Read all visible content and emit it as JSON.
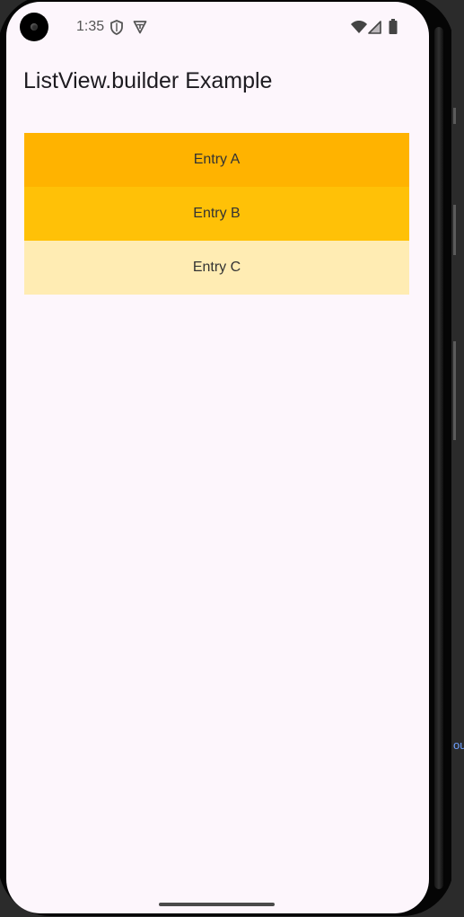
{
  "status_bar": {
    "time": "1:35",
    "icons": [
      "shield-icon",
      "vpn-key-icon",
      "wifi-icon",
      "signal-icon",
      "battery-icon"
    ]
  },
  "app": {
    "title": "ListView.builder Example"
  },
  "list": {
    "items": [
      {
        "label": "Entry A",
        "color": "#ffb300"
      },
      {
        "label": "Entry B",
        "color": "#ffc107"
      },
      {
        "label": "Entry C",
        "color": "#ffecb3"
      }
    ]
  },
  "theme": {
    "background": "#fdf6fc",
    "text": "#1d1b20"
  }
}
